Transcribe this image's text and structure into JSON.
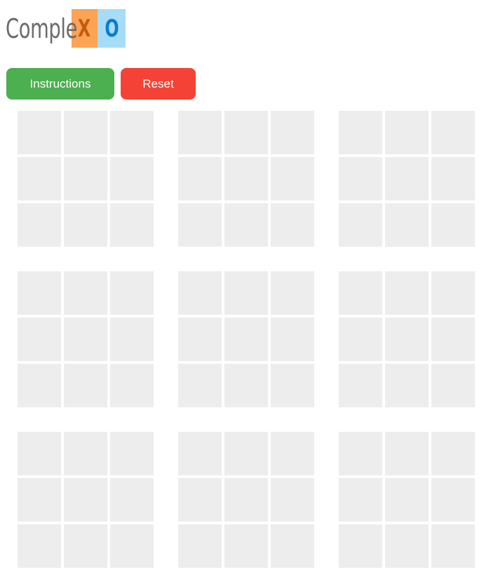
{
  "logo": {
    "text": "Comple",
    "x_letter": "X",
    "o_letter": "O"
  },
  "buttons": {
    "instructions_label": "Instructions",
    "reset_label": "Reset"
  },
  "game": {
    "board_rows": 3,
    "board_cols": 3,
    "cells_per_board": 9,
    "cell_marks": []
  },
  "colors": {
    "x_accent": "#fca354",
    "o_accent": "#a6dcf8",
    "instructions_button": "#4caf50",
    "reset_button": "#f44336",
    "empty_cell": "#ededed"
  }
}
